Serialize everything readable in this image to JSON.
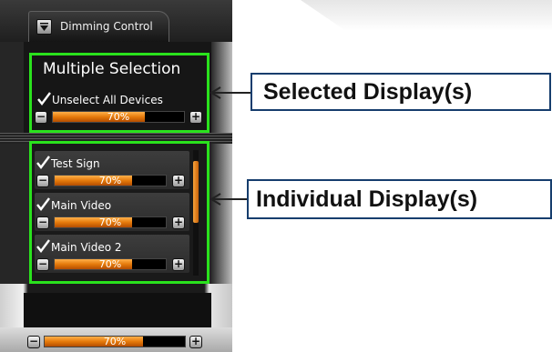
{
  "colors": {
    "highlight_border": "#2ae21d",
    "bar_fill": "#e57a0b",
    "callout_border": "#163d6d",
    "panel_bg": "#262626"
  },
  "tab": {
    "label": "Dimming Control",
    "icon": "dropdown-triangle-icon"
  },
  "multiple_selection": {
    "title": "Multiple Selection",
    "unselect_label": "Unselect All Devices",
    "checked": true,
    "level_text": "70%",
    "level_value": 0.7
  },
  "displays": [
    {
      "name": "Test Sign",
      "checked": true,
      "level_text": "70%",
      "level_value": 0.7
    },
    {
      "name": "Main Video",
      "checked": true,
      "level_text": "70%",
      "level_value": 0.7
    },
    {
      "name": "Main Video 2",
      "checked": true,
      "level_text": "70%",
      "level_value": 0.7
    }
  ],
  "bottom_bar": {
    "level_text": "70%",
    "level_value": 0.7
  },
  "buttons": {
    "minus": "−",
    "plus": "+"
  },
  "callouts": {
    "selected": "Selected Display(s)",
    "individual": "Individual Display(s)"
  }
}
